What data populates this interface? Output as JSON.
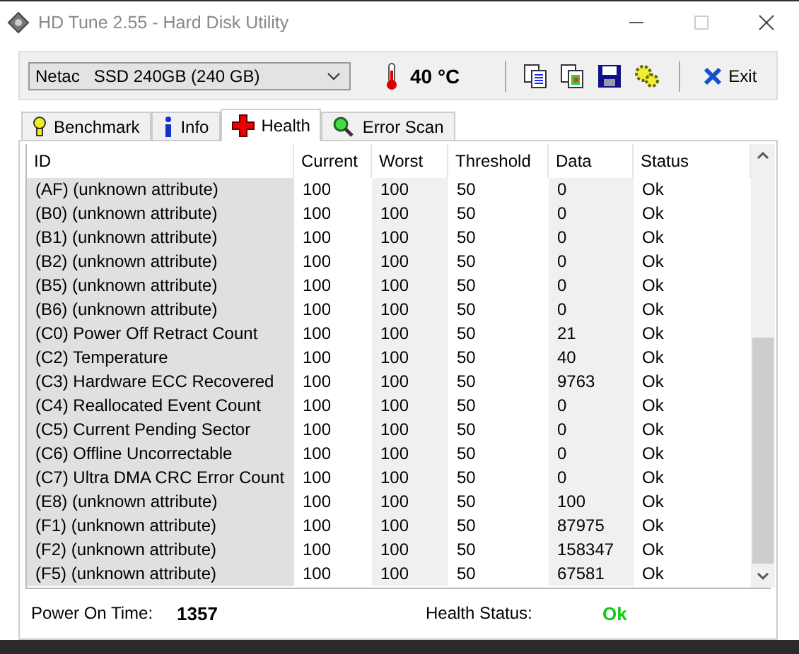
{
  "window": {
    "title": "HD Tune 2.55 - Hard Disk Utility"
  },
  "toolbar": {
    "drive": "Netac   SSD 240GB (240 GB)",
    "temperature": "40 °C",
    "exit": "Exit"
  },
  "tabs": [
    {
      "label": "Benchmark",
      "selected": false
    },
    {
      "label": "Info",
      "selected": false
    },
    {
      "label": "Health",
      "selected": true
    },
    {
      "label": "Error Scan",
      "selected": false
    }
  ],
  "table": {
    "columns": [
      "ID",
      "Current",
      "Worst",
      "Threshold",
      "Data",
      "Status"
    ],
    "rows": [
      [
        "(AF) (unknown attribute)",
        "100",
        "100",
        "50",
        "0",
        "Ok"
      ],
      [
        "(B0) (unknown attribute)",
        "100",
        "100",
        "50",
        "0",
        "Ok"
      ],
      [
        "(B1) (unknown attribute)",
        "100",
        "100",
        "50",
        "0",
        "Ok"
      ],
      [
        "(B2) (unknown attribute)",
        "100",
        "100",
        "50",
        "0",
        "Ok"
      ],
      [
        "(B5) (unknown attribute)",
        "100",
        "100",
        "50",
        "0",
        "Ok"
      ],
      [
        "(B6) (unknown attribute)",
        "100",
        "100",
        "50",
        "0",
        "Ok"
      ],
      [
        "(C0) Power Off Retract Count",
        "100",
        "100",
        "50",
        "21",
        "Ok"
      ],
      [
        "(C2) Temperature",
        "100",
        "100",
        "50",
        "40",
        "Ok"
      ],
      [
        "(C3) Hardware ECC Recovered",
        "100",
        "100",
        "50",
        "9763",
        "Ok"
      ],
      [
        "(C4) Reallocated Event Count",
        "100",
        "100",
        "50",
        "0",
        "Ok"
      ],
      [
        "(C5) Current Pending Sector",
        "100",
        "100",
        "50",
        "0",
        "Ok"
      ],
      [
        "(C6) Offline Uncorrectable",
        "100",
        "100",
        "50",
        "0",
        "Ok"
      ],
      [
        "(C7) Ultra DMA CRC Error Count",
        "100",
        "100",
        "50",
        "0",
        "Ok"
      ],
      [
        "(E8) (unknown attribute)",
        "100",
        "100",
        "50",
        "100",
        "Ok"
      ],
      [
        "(F1) (unknown attribute)",
        "100",
        "100",
        "50",
        "87975",
        "Ok"
      ],
      [
        "(F2) (unknown attribute)",
        "100",
        "100",
        "50",
        "158347",
        "Ok"
      ],
      [
        "(F5) (unknown attribute)",
        "100",
        "100",
        "50",
        "67581",
        "Ok"
      ]
    ]
  },
  "footer": {
    "power_on_label": "Power On Time:",
    "power_on_value": "1357",
    "health_label": "Health Status:",
    "health_value": "Ok"
  }
}
